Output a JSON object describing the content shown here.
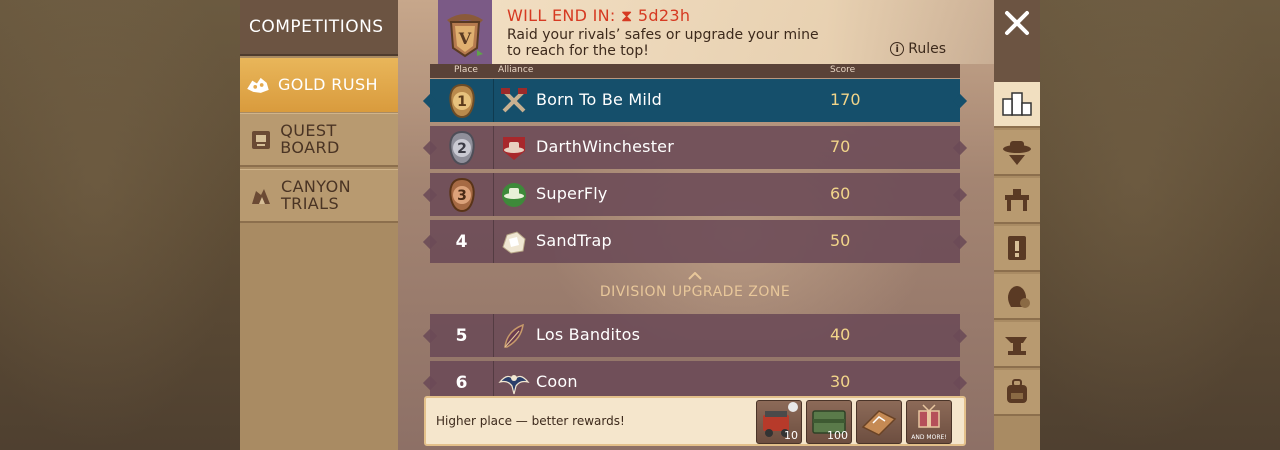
{
  "left_menu": {
    "title": "COMPETITIONS",
    "items": [
      {
        "label": "GOLD RUSH",
        "icon": "gold-nugget-icon",
        "active": true
      },
      {
        "label": "QUEST BOARD",
        "icon": "quest-board-icon",
        "active": false
      },
      {
        "label": "CANYON TRIALS",
        "icon": "canyon-icon",
        "active": false
      }
    ]
  },
  "header": {
    "badge": "V",
    "timer_label": "WILL END IN: ⧗ 5d23h",
    "description": "Raid your rivals’ safes or upgrade your mine to reach for the top!",
    "rules_label": "Rules"
  },
  "table": {
    "columns": [
      "Place",
      "Alliance",
      "Score"
    ],
    "rows": [
      {
        "place": "1",
        "name": "Born To Be Mild",
        "score": "170",
        "icon": "crossed-axes-icon",
        "highlight": true
      },
      {
        "place": "2",
        "name": "DarthWinchester",
        "score": "70",
        "icon": "red-cowboy-hat-icon",
        "highlight": false
      },
      {
        "place": "3",
        "name": "SuperFly",
        "score": "60",
        "icon": "green-cowboy-hat-icon",
        "highlight": false
      },
      {
        "place": "4",
        "name": "SandTrap",
        "score": "50",
        "icon": "sand-rock-icon",
        "highlight": false
      },
      {
        "place": "5",
        "name": "Los Banditos",
        "score": "40",
        "icon": "feather-icon",
        "highlight": false
      },
      {
        "place": "6",
        "name": "Coon",
        "score": "30",
        "icon": "eagle-icon",
        "highlight": false
      }
    ],
    "zone_label": "DIVISION UPGRADE ZONE"
  },
  "footer": {
    "text": "Higher place — better rewards!",
    "rewards": [
      {
        "icon": "mine-cart-icon",
        "count": "10"
      },
      {
        "icon": "crate-icon",
        "count": "100"
      },
      {
        "icon": "box-icon",
        "count": ""
      },
      {
        "icon": "gift-icon",
        "count": "",
        "more": "AND MORE!"
      }
    ]
  },
  "right_tabs": [
    "leaderboard-icon",
    "cowboy-icon",
    "workbench-icon",
    "quest-icon",
    "money-bag-icon",
    "anvil-icon",
    "backpack-icon"
  ],
  "colors": {
    "highlight_row": "#154f6b",
    "row": "#6b4a56",
    "accent": "#d63a22",
    "score": "#f2d58a"
  }
}
